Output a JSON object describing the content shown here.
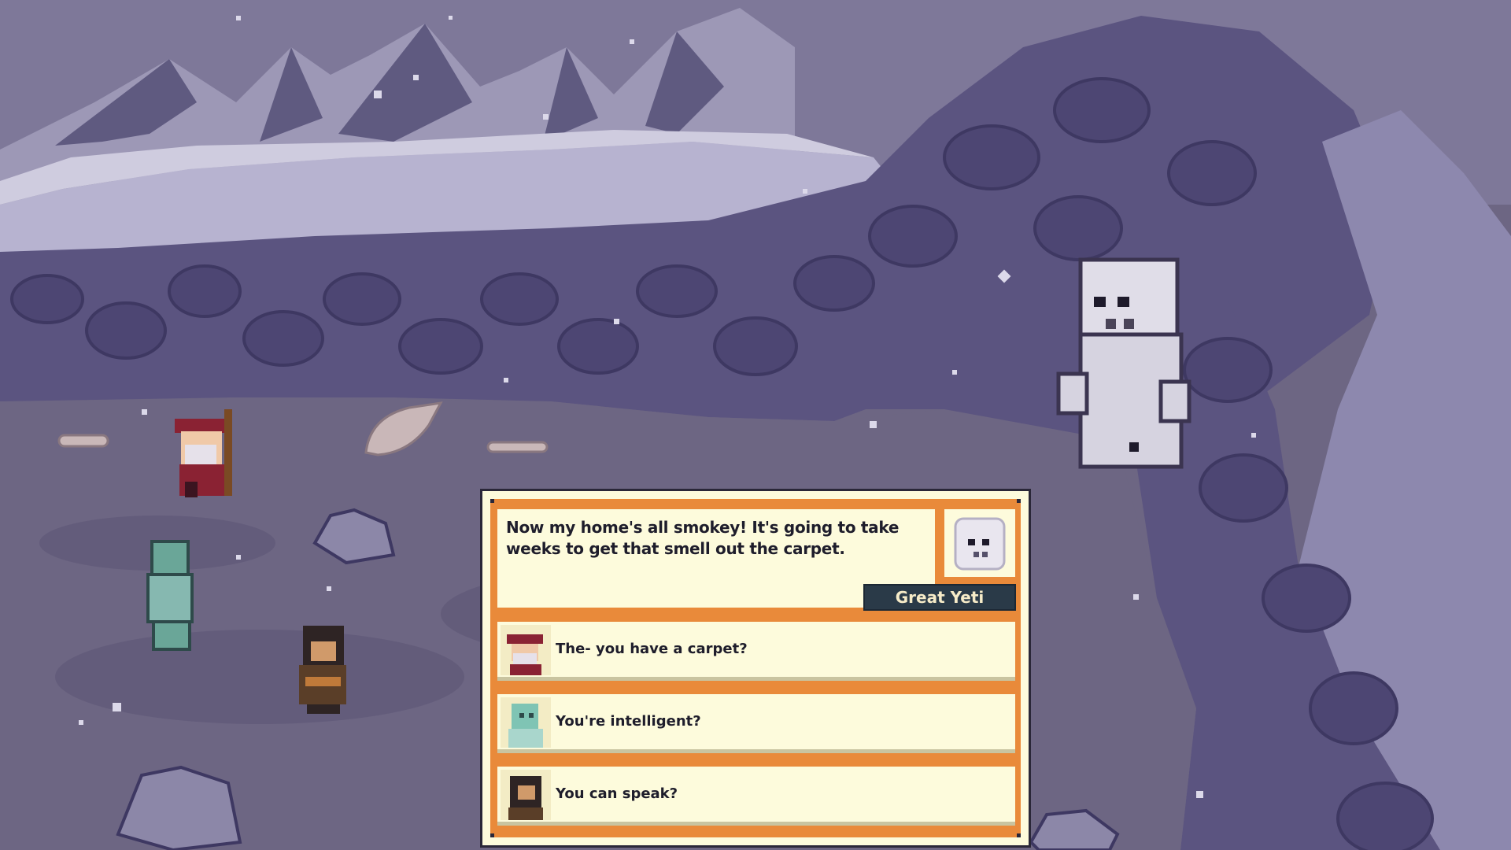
{
  "dialog": {
    "speech": "Now my home's all smokey! It's going to take weeks to get that smell out the carpet.",
    "speaker": "Great Yeti",
    "choices": [
      {
        "label": "The- you have a carpet?",
        "portrait": "red-hat-wizard-portrait"
      },
      {
        "label": "You're intelligent?",
        "portrait": "green-zombie-portrait"
      },
      {
        "label": "You can speak?",
        "portrait": "bearded-warrior-portrait"
      }
    ]
  },
  "colors": {
    "panel": "#fdfbdc",
    "frame": "#e98a3a",
    "speaker_tag": "#2a3a48",
    "ground": "#6d6683",
    "rock": "#5b5480",
    "snow": "#a39ec2"
  }
}
